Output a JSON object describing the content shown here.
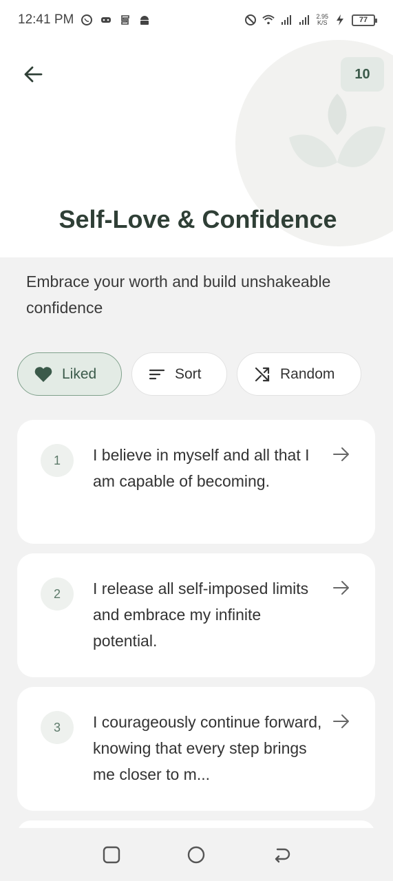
{
  "status_bar": {
    "time": "12:41 PM",
    "net_speed_value": "2.95",
    "net_speed_unit": "K/S",
    "battery": "77"
  },
  "header": {
    "count": "10",
    "title": "Self-Love & Confidence"
  },
  "subtitle": "Embrace your worth and build unshakeable confidence",
  "filters": [
    {
      "label": "Liked",
      "icon": "heart-icon",
      "active": true
    },
    {
      "label": "Sort",
      "icon": "sort-icon",
      "active": false
    },
    {
      "label": "Random",
      "icon": "shuffle-icon",
      "active": false
    }
  ],
  "affirmations": [
    {
      "number": "1",
      "text": "I believe in myself and all that I am capable of becoming."
    },
    {
      "number": "2",
      "text": "I release all self-imposed limits and embrace my infinite potential."
    },
    {
      "number": "3",
      "text": "I courageously continue forward, knowing that every step brings me closer to m..."
    }
  ],
  "colors": {
    "accent": "#3b5a4a",
    "chip_active_bg": "#e3ebe5",
    "badge_bg": "#e3e9e5"
  }
}
